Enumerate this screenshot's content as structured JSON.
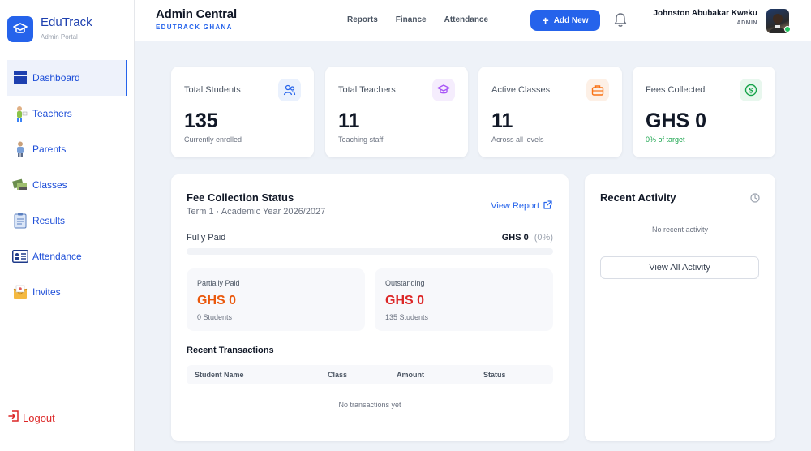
{
  "brand": {
    "name": "EduTrack",
    "subtitle": "Admin Portal",
    "logo_icon": "graduation-cap-icon"
  },
  "sidebar": {
    "items": [
      {
        "label": "Dashboard",
        "icon": "dashboard-icon",
        "active": true
      },
      {
        "label": "Teachers",
        "icon": "teacher-icon"
      },
      {
        "label": "Parents",
        "icon": "parent-icon"
      },
      {
        "label": "Classes",
        "icon": "classes-icon"
      },
      {
        "label": "Results",
        "icon": "results-icon"
      },
      {
        "label": "Attendance",
        "icon": "attendance-icon"
      },
      {
        "label": "Invites",
        "icon": "invites-icon"
      }
    ],
    "logout_label": "Logout"
  },
  "header": {
    "title": "Admin Central",
    "subtitle": "EDUTRACK GHANA",
    "links": [
      "Reports",
      "Finance",
      "Attendance"
    ],
    "add_new_label": "Add New",
    "user_name": "Johnston Abubakar Kweku",
    "user_role": "ADMIN"
  },
  "stats": [
    {
      "label": "Total Students",
      "value": "135",
      "sub": "Currently enrolled",
      "icon": "users-icon",
      "accent": "#2563eb",
      "bg": "#eaf1fd"
    },
    {
      "label": "Total Teachers",
      "value": "11",
      "sub": "Teaching staff",
      "icon": "graduation-cap-icon",
      "accent": "#a855f7",
      "bg": "#f5edfd"
    },
    {
      "label": "Active Classes",
      "value": "11",
      "sub": "Across all levels",
      "icon": "briefcase-icon",
      "accent": "#f97316",
      "bg": "#fdf0e6"
    },
    {
      "label": "Fees Collected",
      "value": "GHS 0",
      "sub": "0% of target",
      "icon": "dollar-icon",
      "accent": "#16a34a",
      "bg": "#e8f7ee"
    }
  ],
  "fees": {
    "title": "Fee Collection Status",
    "subtitle": "Term 1 · Academic Year 2026/2027",
    "view_report_label": "View Report",
    "fully_paid_label": "Fully Paid",
    "fully_paid_amount": "GHS 0",
    "fully_paid_pct": "(0%)",
    "fully_paid_fraction": 0,
    "partially": {
      "label": "Partially Paid",
      "value": "GHS 0",
      "sub": "0 Students",
      "color": "#ea580c"
    },
    "outstanding": {
      "label": "Outstanding",
      "value": "GHS 0",
      "sub": "135 Students",
      "color": "#dc2626"
    },
    "transactions_title": "Recent Transactions",
    "columns": [
      "Student Name",
      "Class",
      "Amount",
      "Status"
    ],
    "empty_text": "No transactions yet"
  },
  "activity": {
    "title": "Recent Activity",
    "empty_text": "No recent activity",
    "view_all_label": "View All Activity"
  }
}
